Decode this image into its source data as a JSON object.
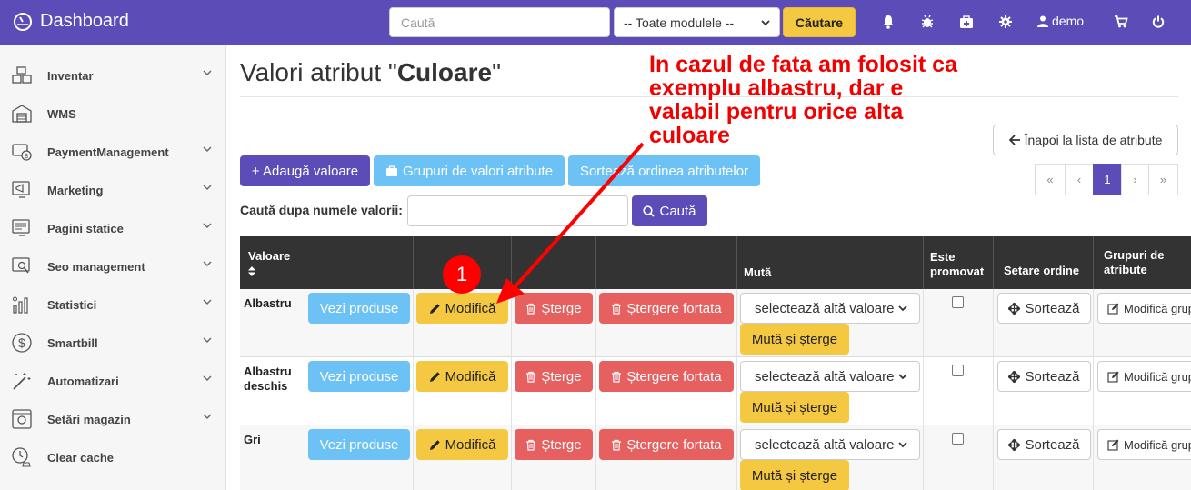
{
  "topbar": {
    "brand": "Dashboard",
    "search_placeholder": "Caută",
    "module_select": "-- Toate modulele --",
    "search_button": "Căutare",
    "user": "demo"
  },
  "sidebar": {
    "items": [
      {
        "label": "Inventar",
        "icon": "boxes-icon",
        "chevron": true
      },
      {
        "label": "WMS",
        "icon": "warehouse-icon",
        "chevron": false
      },
      {
        "label": "PaymentManagement",
        "icon": "payment-icon",
        "chevron": true
      },
      {
        "label": "Marketing",
        "icon": "marketing-icon",
        "chevron": true
      },
      {
        "label": "Pagini statice",
        "icon": "pages-icon",
        "chevron": true
      },
      {
        "label": "Seo management",
        "icon": "seo-icon",
        "chevron": true
      },
      {
        "label": "Statistici",
        "icon": "stats-icon",
        "chevron": true
      },
      {
        "label": "Smartbill",
        "icon": "dollar-icon",
        "chevron": true
      },
      {
        "label": "Automatizari",
        "icon": "magic-wand-icon",
        "chevron": true
      },
      {
        "label": "Setări magazin",
        "icon": "settings-icon",
        "chevron": true
      },
      {
        "label": "Clear cache",
        "icon": "clear-cache-icon",
        "chevron": false
      }
    ]
  },
  "main": {
    "title_prefix": "Valori atribut \"",
    "title_name": "Culoare",
    "title_suffix": "\"",
    "back_button": "Înapoi la lista de atribute",
    "add_button": "+ Adaugă valoare",
    "groups_button": "Grupuri de valori atribute",
    "sort_attr_button": "Sortează ordinea atributelor",
    "search_label": "Caută dupa numele valorii:",
    "search_button": "Caută",
    "pagination": [
      "«",
      "‹",
      "1",
      "›",
      "»"
    ],
    "annotation": "In cazul de fata am folosit ca exemplu albastru, dar e valabil pentru orice alta culoare",
    "badge": "1"
  },
  "table": {
    "headers": {
      "valoare": "Valoare",
      "muta": "Mută",
      "promovat": "Este promovat",
      "ordine": "Setare ordine",
      "grupuri": "Grupuri de atribute"
    },
    "buttons": {
      "vezi": "Vezi produse",
      "modifica": "Modifică",
      "sterge": "Șterge",
      "sterge_fortat": "Ștergere fortata",
      "select": "selectează altă valoare",
      "muta": "Mută și șterge",
      "sorteaza": "Sortează",
      "modifica_grup": "Modifică grup"
    },
    "rows": [
      {
        "name": "Albastru"
      },
      {
        "name": "Albastru deschis"
      },
      {
        "name": "Gri"
      }
    ]
  },
  "colors": {
    "primary": "#5b4cb8",
    "info": "#6cc1f5",
    "warning": "#f5c842",
    "danger": "#e66060",
    "annotation": "#f20000"
  }
}
